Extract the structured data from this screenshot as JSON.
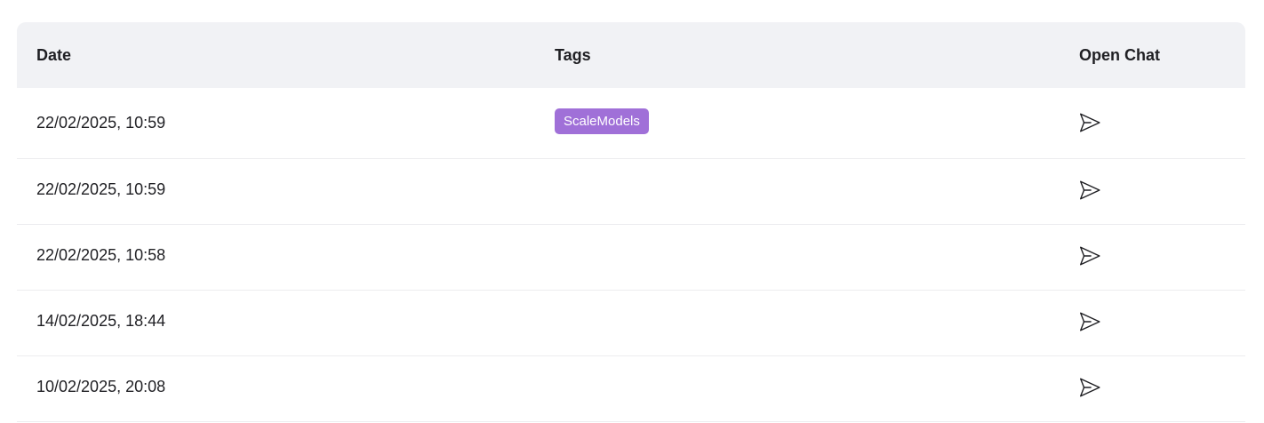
{
  "table": {
    "headers": {
      "date": "Date",
      "tags": "Tags",
      "open_chat": "Open Chat"
    },
    "rows": [
      {
        "date": "22/02/2025, 10:59",
        "tag": "ScaleModels",
        "open_icon": "send-icon"
      },
      {
        "date": "22/02/2025, 10:59",
        "tag": "",
        "open_icon": "send-icon"
      },
      {
        "date": "22/02/2025, 10:58",
        "tag": "",
        "open_icon": "send-icon"
      },
      {
        "date": "14/02/2025, 18:44",
        "tag": "",
        "open_icon": "send-icon"
      },
      {
        "date": "10/02/2025, 20:08",
        "tag": "",
        "open_icon": "send-icon"
      }
    ]
  },
  "colors": {
    "header_bg": "#f1f2f5",
    "tag_bg": "#a070d8",
    "divider": "#ececef"
  }
}
